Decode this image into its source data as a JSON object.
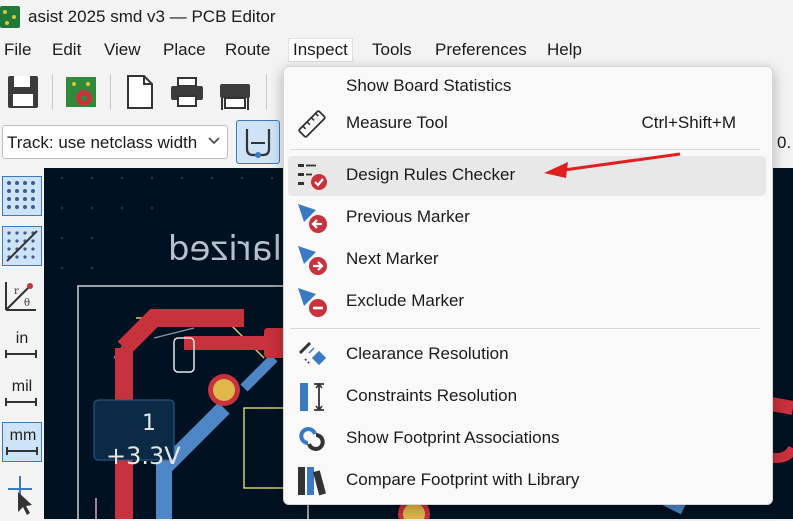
{
  "window": {
    "title": "asist 2025 smd v3 — PCB Editor"
  },
  "menubar": {
    "items": [
      "File",
      "Edit",
      "View",
      "Place",
      "Route",
      "Inspect",
      "Tools",
      "Preferences",
      "Help"
    ],
    "active": "Inspect"
  },
  "toolbar": {
    "track_select": "Track: use netclass width",
    "right_value": "0."
  },
  "left_toolbar": {
    "in_label": "in",
    "mil_label": "mil",
    "mm_label": "mm"
  },
  "canvas": {
    "text_mirrored": "larized",
    "net_label_1": "1",
    "net_label_v": "+3.3V"
  },
  "inspect_menu": {
    "items": [
      {
        "label": "Show Board Statistics",
        "shortcut": "",
        "icon": "blank"
      },
      {
        "label": "Measure Tool",
        "shortcut": "Ctrl+Shift+M",
        "icon": "ruler-icon"
      },
      {
        "label": "Design Rules Checker",
        "shortcut": "",
        "icon": "drc-icon"
      },
      {
        "label": "Previous Marker",
        "shortcut": "",
        "icon": "previous-marker-icon"
      },
      {
        "label": "Next Marker",
        "shortcut": "",
        "icon": "next-marker-icon"
      },
      {
        "label": "Exclude Marker",
        "shortcut": "",
        "icon": "exclude-marker-icon"
      },
      {
        "label": "Clearance Resolution",
        "shortcut": "",
        "icon": "clearance-icon"
      },
      {
        "label": "Constraints Resolution",
        "shortcut": "",
        "icon": "constraints-icon"
      },
      {
        "label": "Show Footprint Associations",
        "shortcut": "",
        "icon": "footprint-assoc-icon"
      },
      {
        "label": "Compare Footprint with Library",
        "shortcut": "",
        "icon": "library-compare-icon"
      }
    ],
    "highlighted": "Design Rules Checker"
  },
  "colors": {
    "accent": "#3a79c4",
    "arrow": "#e02020",
    "canvas_bg": "#001222",
    "track_red": "#c8323c",
    "track_blue": "#4f86c6"
  }
}
